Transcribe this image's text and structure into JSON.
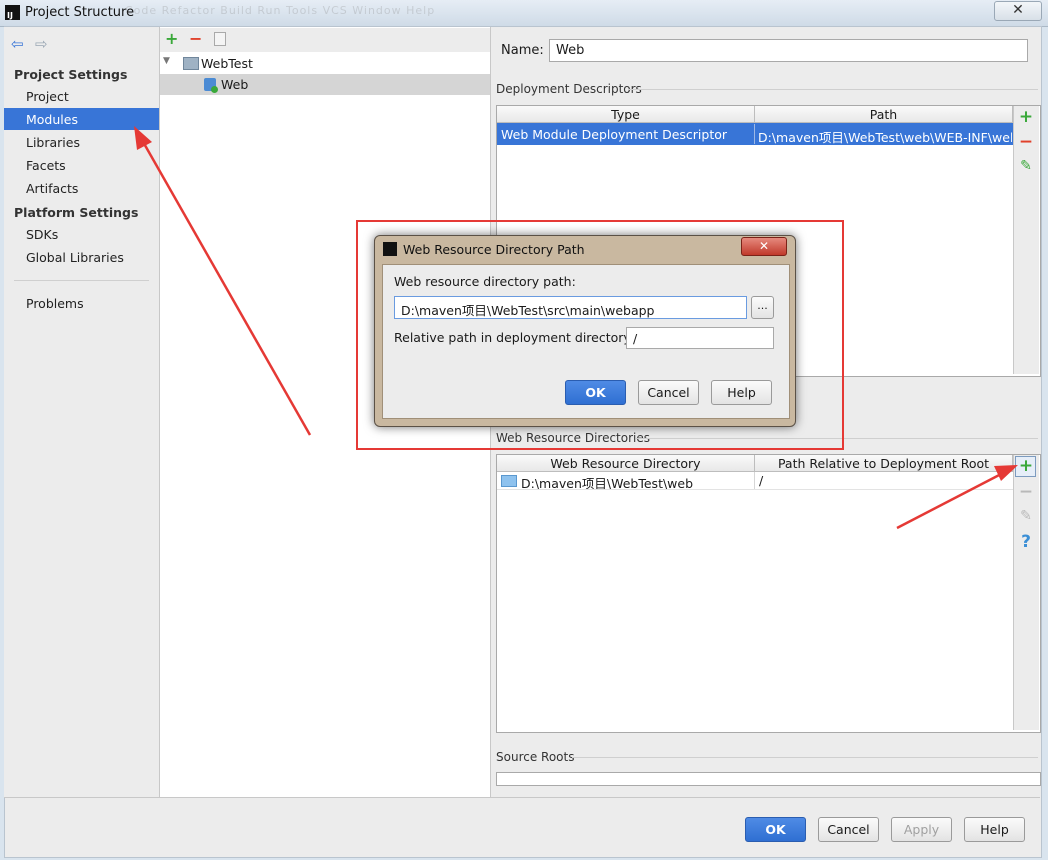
{
  "window": {
    "title": "Project Structure",
    "icon_label": "IJ",
    "ghost_menu": "Code  Refactor  Build  Run  Tools  VCS  Window  Help"
  },
  "nav": {
    "back_icon": "arrow-left-icon",
    "forward_icon": "arrow-right-icon",
    "project_settings": {
      "header": "Project Settings",
      "items": [
        "Project",
        "Modules",
        "Libraries",
        "Facets",
        "Artifacts"
      ],
      "selected": "Modules"
    },
    "platform_settings": {
      "header": "Platform Settings",
      "items": [
        "SDKs",
        "Global Libraries"
      ]
    },
    "problems": "Problems"
  },
  "tree": {
    "toolbar": {
      "add": "+",
      "remove": "−"
    },
    "root": "WebTest",
    "child": "Web"
  },
  "detail": {
    "name_label": "Name:",
    "name_value": "Web",
    "deployment_descriptors": {
      "title": "Deployment Descriptors",
      "columns": [
        "Type",
        "Path"
      ],
      "rows": [
        [
          "Web Module Deployment Descriptor",
          "D:\\maven项目\\WebTest\\web\\WEB-INF\\web."
        ]
      ]
    },
    "web_resource_directories": {
      "title": "Web Resource Directories",
      "columns": [
        "Web Resource Directory",
        "Path Relative to Deployment Root"
      ],
      "rows": [
        [
          "D:\\maven项目\\WebTest\\web",
          "/"
        ]
      ]
    },
    "source_roots": {
      "title": "Source Roots"
    },
    "side_buttons": {
      "add": "+",
      "remove": "−",
      "help": "?"
    }
  },
  "dialog": {
    "title": "Web Resource Directory Path",
    "close": "✕",
    "path_label": "Web resource directory path:",
    "path_value": "D:\\maven项目\\WebTest\\src\\main\\webapp",
    "browse": "...",
    "relative_label": "Relative path in deployment directory:",
    "relative_value": "/",
    "ok": "OK",
    "cancel": "Cancel",
    "help": "Help"
  },
  "footer": {
    "ok": "OK",
    "cancel": "Cancel",
    "apply": "Apply",
    "help": "Help"
  },
  "colors": {
    "selection": "#3875d7",
    "annotation_red": "#e53935",
    "add_green": "#3aa83a",
    "remove_red": "#e0402a"
  }
}
